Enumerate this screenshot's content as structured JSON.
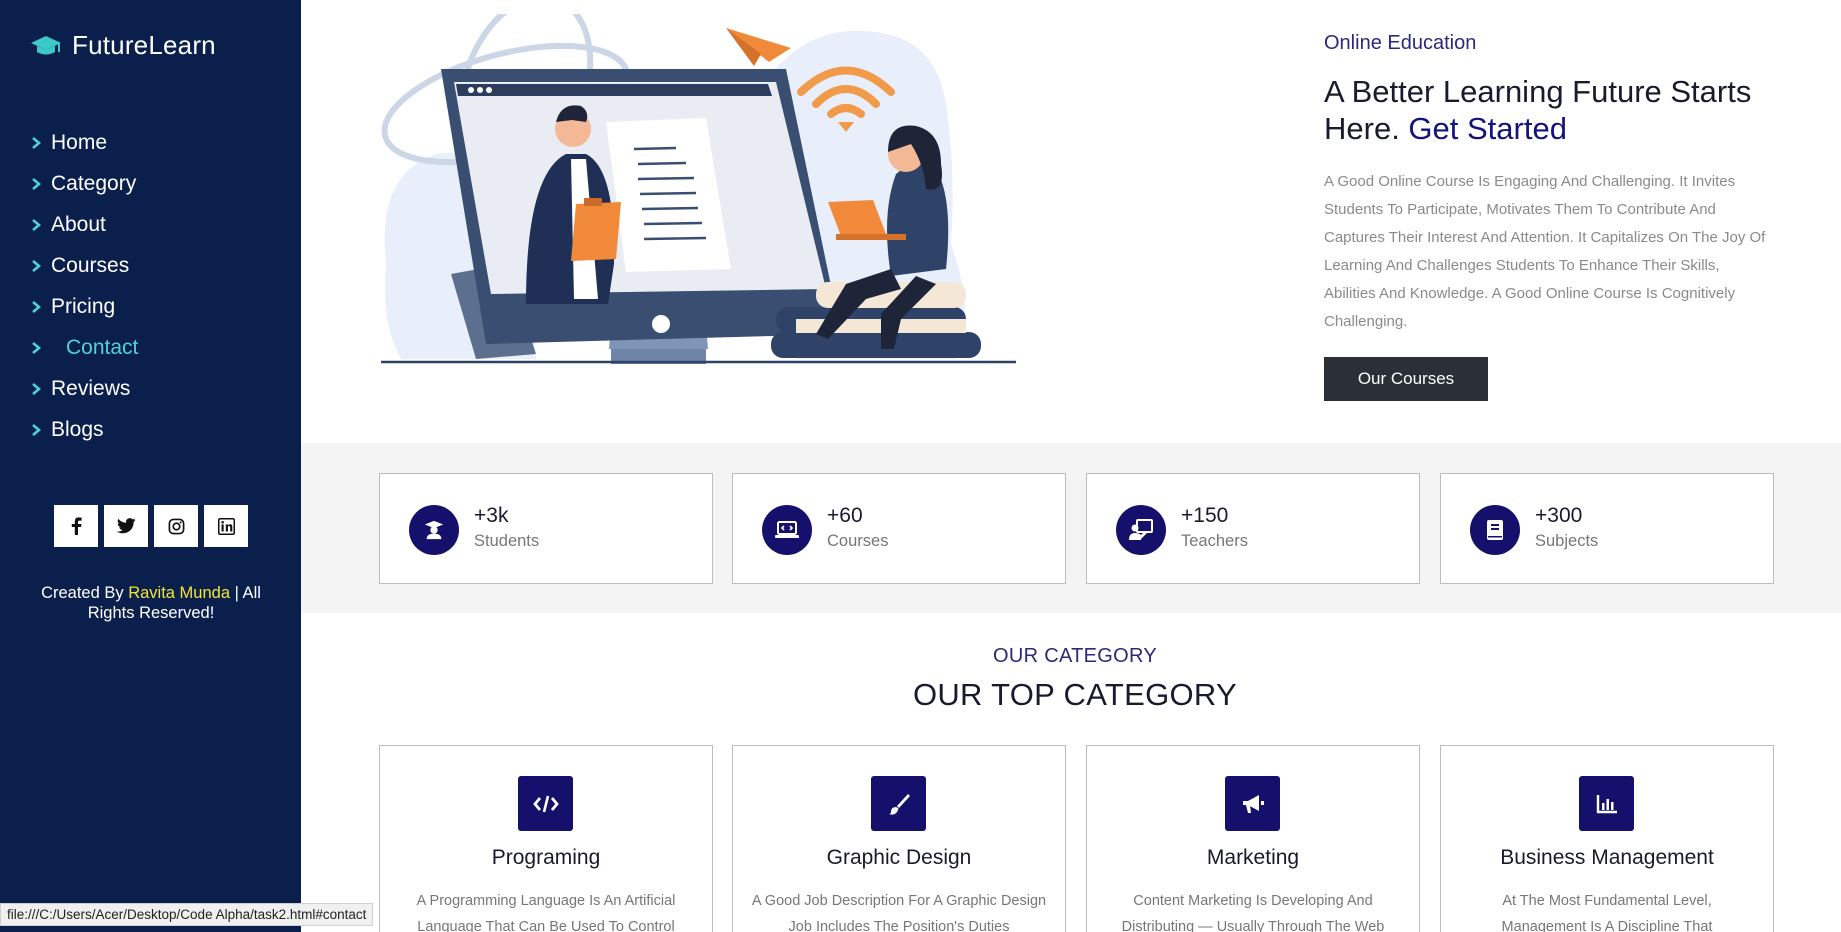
{
  "brand": {
    "name": "FutureLearn",
    "icon": "graduation-cap-icon"
  },
  "nav": {
    "items": [
      {
        "label": "Home",
        "active": false
      },
      {
        "label": "Category",
        "active": false
      },
      {
        "label": "About",
        "active": false
      },
      {
        "label": "Courses",
        "active": false
      },
      {
        "label": "Pricing",
        "active": false
      },
      {
        "label": "Contact",
        "active": true
      },
      {
        "label": "Reviews",
        "active": false
      },
      {
        "label": "Blogs",
        "active": false
      }
    ]
  },
  "socials": [
    "facebook-icon",
    "twitter-icon",
    "instagram-icon",
    "linkedin-icon"
  ],
  "credits": {
    "prefix": "Created By ",
    "author": "Ravita Munda",
    "suffix": " | All Rights Reserved!"
  },
  "hero": {
    "eyebrow": "Online Education",
    "headline_1": "A Better Learning Future Starts Here. ",
    "headline_accent": "Get Started",
    "description": "A Good Online Course Is Engaging And Challenging. It Invites Students To Participate, Motivates Them To Contribute And Captures Their Interest And Attention. It Capitalizes On The Joy Of Learning And Challenges Students To Enhance Their Skills, Abilities And Knowledge. A Good Online Course Is Cognitively Challenging.",
    "cta_label": "Our Courses"
  },
  "stats": [
    {
      "value": "+3k",
      "label": "Students",
      "icon": "student-icon"
    },
    {
      "value": "+60",
      "label": "Courses",
      "icon": "laptop-code-icon"
    },
    {
      "value": "+150",
      "label": "Teachers",
      "icon": "teacher-icon"
    },
    {
      "value": "+300",
      "label": "Subjects",
      "icon": "book-icon"
    }
  ],
  "category_section": {
    "eyebrow": "OUR CATEGORY",
    "title": "OUR TOP CATEGORY"
  },
  "categories": [
    {
      "title": "Programing",
      "icon": "code-icon",
      "description": "A Programming Language Is An Artificial Language That Can Be Used To Control"
    },
    {
      "title": "Graphic Design",
      "icon": "paint-brush-icon",
      "description": "A Good Job Description For A Graphic Design Job Includes The Position's Duties"
    },
    {
      "title": "Marketing",
      "icon": "megaphone-icon",
      "description": "Content Marketing Is Developing And Distributing — Usually Through The Web"
    },
    {
      "title": "Business Management",
      "icon": "chart-bar-icon",
      "description": "At The Most Fundamental Level, Management Is A Discipline That"
    }
  ],
  "status_url": "file:///C:/Users/Acer/Desktop/Code Alpha/task2.html#contact",
  "colors": {
    "sidebar_bg": "#0b1f4d",
    "accent_dark": "#15106b",
    "active_nav": "#4fd2d6",
    "author": "#f2e53a",
    "cta_bg": "#2b3036"
  }
}
